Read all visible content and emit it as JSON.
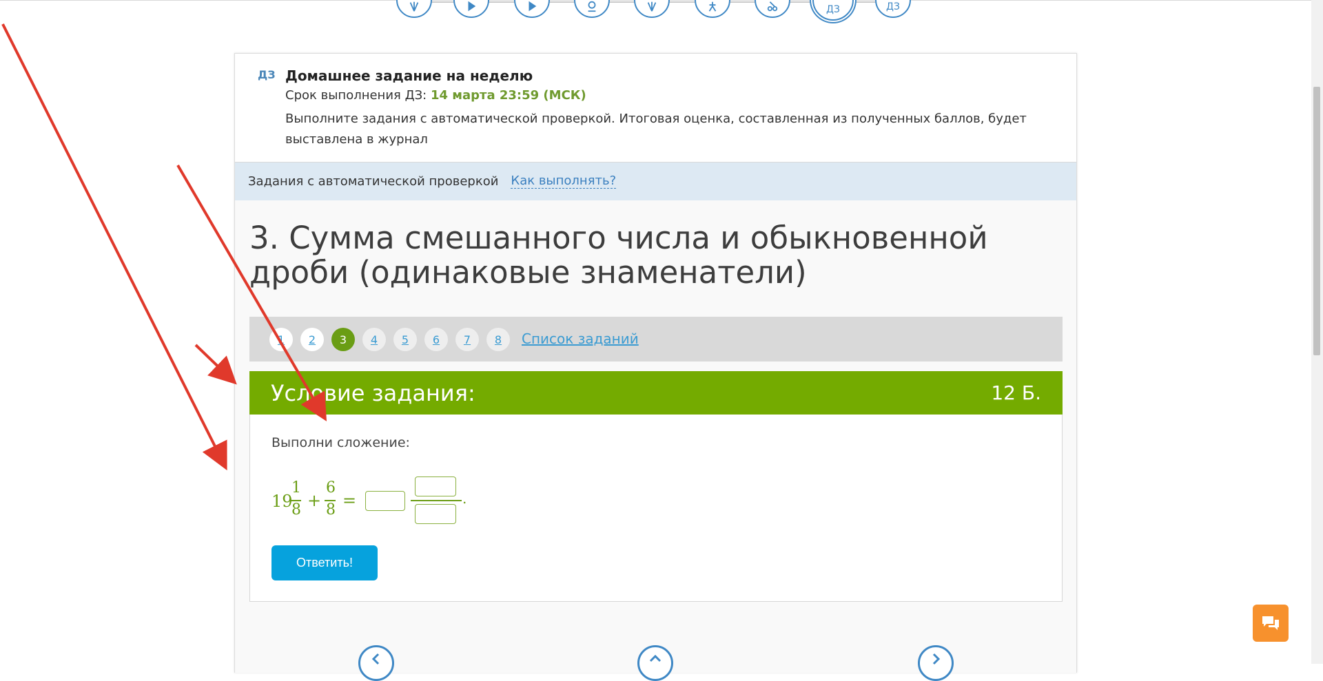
{
  "lesson_nav": {
    "steps": [
      {
        "icon": "theory-icon"
      },
      {
        "icon": "play-icon"
      },
      {
        "icon": "play-icon"
      },
      {
        "icon": "webinar-icon"
      },
      {
        "icon": "theory-icon"
      },
      {
        "icon": "training-icon"
      },
      {
        "icon": "test-icon"
      },
      {
        "icon": "homework-icon",
        "label": "ДЗ",
        "current": true
      },
      {
        "icon": "homework-icon",
        "label": "ДЗ"
      }
    ]
  },
  "homework": {
    "badge": "ДЗ",
    "title": "Домашнее задание на неделю",
    "deadline_label": "Срок выполнения ДЗ: ",
    "deadline_value": "14 марта 23:59 (МСК)",
    "description": "Выполните задания с автоматической проверкой. Итоговая оценка, составленная из полученных баллов, будет выставлена в журнал"
  },
  "auto_check": {
    "label": "Задания с автоматической проверкой",
    "how_to_link": "Как выполнять?"
  },
  "task": {
    "title": "3. Сумма смешанного числа и обыкновенной дроби (одинаковые знаменатели)"
  },
  "pager": {
    "pages": [
      "1",
      "2",
      "3",
      "4",
      "5",
      "6",
      "7",
      "8"
    ],
    "active": "3",
    "list_link": "Список заданий"
  },
  "condition": {
    "header": "Условие задания:",
    "points": "12 Б.",
    "instruction": "Выполни сложение:",
    "expression": {
      "whole": "19",
      "num1": "1",
      "den1": "8",
      "plus": "+",
      "num2": "6",
      "den2": "8",
      "equals": "=",
      "period": "."
    },
    "answer_button": "Ответить!"
  },
  "colors": {
    "accent_green": "#74ab00",
    "link_blue": "#3a9bd2",
    "button_blue": "#06a2dd",
    "chat_orange": "#f7912d",
    "annotation_red": "#e0392b"
  }
}
